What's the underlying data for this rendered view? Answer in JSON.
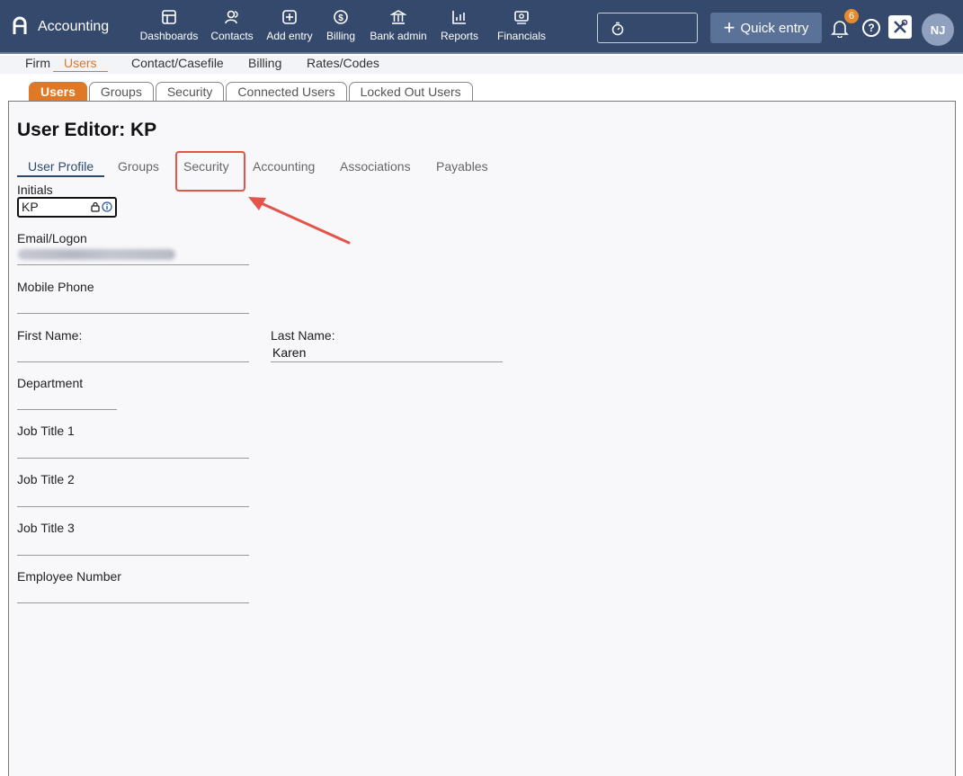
{
  "topbar": {
    "brand": "Accounting",
    "nav": [
      {
        "label": "Dashboards"
      },
      {
        "label": "Contacts"
      },
      {
        "label": "Add entry"
      },
      {
        "label": "Billing"
      },
      {
        "label": "Bank admin"
      },
      {
        "label": "Reports"
      },
      {
        "label": "Financials"
      }
    ],
    "quick_entry": "Quick entry",
    "notification_count": "6",
    "help_glyph": "?",
    "avatar_initials": "NJ"
  },
  "subnav": [
    "Firm",
    "Users",
    "Contact/Casefile",
    "Billing",
    "Rates/Codes"
  ],
  "tabs": [
    "Users",
    "Groups",
    "Security",
    "Connected Users",
    "Locked Out Users"
  ],
  "editor": {
    "title": "User Editor: KP",
    "subtabs": [
      "User Profile",
      "Groups",
      "Security",
      "Accounting",
      "Associations",
      "Payables"
    ],
    "fields": {
      "initials_label": "Initials",
      "initials_value": "KP",
      "email_label": "Email/Logon",
      "mobile_label": "Mobile Phone",
      "first_name_label": "First Name:",
      "last_name_label": "Last Name:",
      "last_name_value": "Karen",
      "department_label": "Department",
      "job1_label": "Job Title 1",
      "job2_label": "Job Title 2",
      "job3_label": "Job Title 3",
      "employee_label": "Employee Number"
    }
  },
  "colors": {
    "topbar": "#34496b",
    "accent_orange": "#e17826",
    "annotation_red": "#e3544b"
  }
}
